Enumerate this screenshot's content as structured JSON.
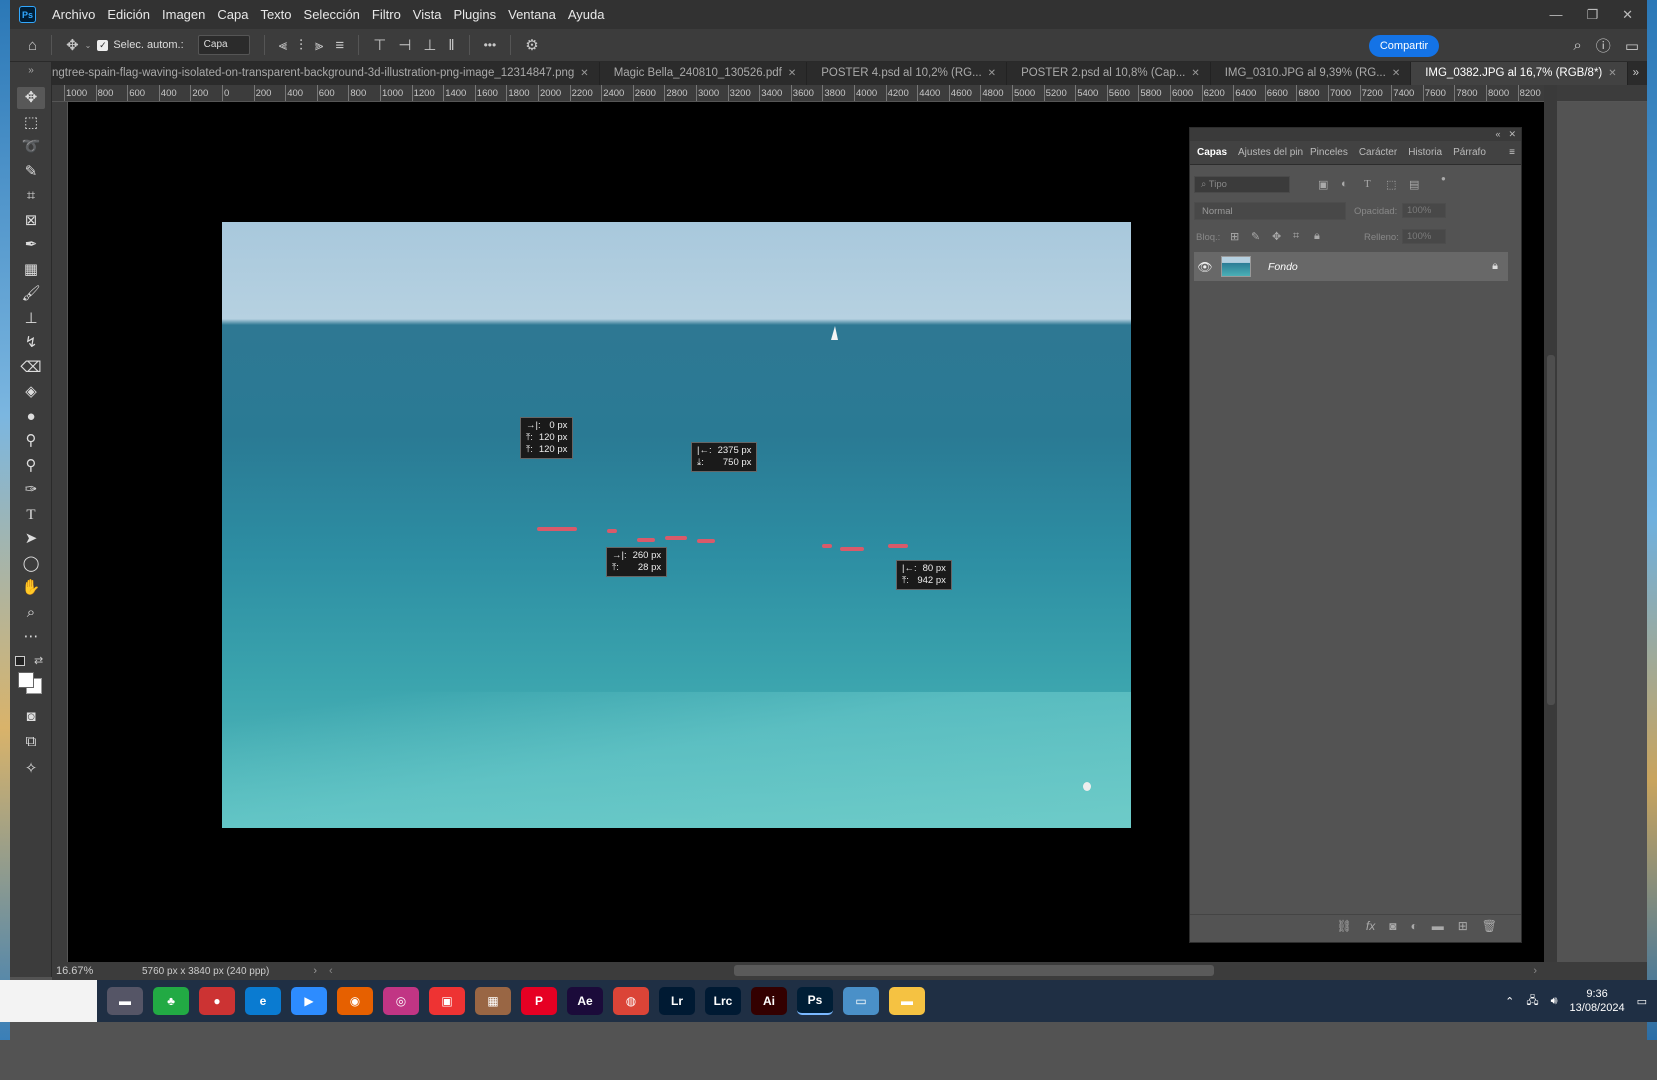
{
  "menubar": {
    "logo": "Ps",
    "items": [
      "Archivo",
      "Edición",
      "Imagen",
      "Capa",
      "Texto",
      "Selección",
      "Filtro",
      "Vista",
      "Plugins",
      "Ventana",
      "Ayuda"
    ],
    "window_controls": [
      "—",
      "❐",
      "✕"
    ]
  },
  "optionsbar": {
    "auto_select_label": "Selec. autom.:",
    "auto_select_checked": true,
    "target_select": "Capa",
    "more_label": "•••",
    "share_label": "Compartir"
  },
  "tabs": [
    {
      "label": "ngtree-spain-flag-waving-isolated-on-transparent-background-3d-illustration-png-image_12314847.png",
      "active": false
    },
    {
      "label": "Magic Bella_240810_130526.pdf",
      "active": false
    },
    {
      "label": "POSTER 4.psd al 10,2% (RG...",
      "active": false
    },
    {
      "label": "POSTER 2.psd al 10,8% (Cap...",
      "active": false
    },
    {
      "label": "IMG_0310.JPG al 9,39% (RG...",
      "active": false
    },
    {
      "label": "IMG_0382.JPG al 16,7% (RGB/8*)",
      "active": true
    }
  ],
  "ruler": {
    "top_ticks": [
      "1000",
      "800",
      "600",
      "400",
      "200",
      "0",
      "200",
      "400",
      "600",
      "800",
      "1000",
      "1200",
      "1400",
      "1600",
      "1800",
      "2000",
      "2200",
      "2400",
      "2600",
      "2800",
      "3000",
      "3200",
      "3400",
      "3600",
      "3800",
      "4000",
      "4200",
      "4400",
      "4600",
      "4800",
      "5000",
      "5200",
      "5400",
      "5600",
      "5800",
      "6000",
      "6200",
      "6400",
      "6600",
      "6800",
      "7000",
      "7200",
      "7400",
      "7600",
      "7800",
      "8000",
      "8200"
    ]
  },
  "measure_tips": [
    {
      "rows": [
        [
          "→|:",
          "0 px"
        ],
        [
          "⤒:",
          "120 px"
        ],
        [
          "⤒:",
          "120 px"
        ]
      ]
    },
    {
      "rows": [
        [
          "|←:",
          "2375 px"
        ],
        [
          "⤓:",
          "750 px"
        ]
      ]
    },
    {
      "rows": [
        [
          "→|:",
          "260 px"
        ],
        [
          "⤒:",
          "28 px"
        ]
      ]
    },
    {
      "rows": [
        [
          "|←:",
          "80 px"
        ],
        [
          "⤒:",
          "942 px"
        ]
      ]
    }
  ],
  "panel": {
    "tabs": [
      "Capas",
      "Ajustes del pin",
      "Pinceles",
      "Carácter",
      "Historia",
      "Párrafo"
    ],
    "active_tab": "Capas",
    "filter_placeholder": "Tipo",
    "blend_mode": "Normal",
    "opacity_label": "Opacidad:",
    "opacity_value": "100%",
    "lock_label": "Bloq.:",
    "fill_label": "Relleno:",
    "fill_value": "100%",
    "layers": [
      {
        "name": "Fondo",
        "visible": true,
        "locked": true
      }
    ]
  },
  "status": {
    "zoom": "16.67%",
    "doc_info": "5760 px x 3840 px (240 ppp)"
  },
  "taskbar": {
    "apps": [
      "folder-sm",
      "game",
      "maps",
      "edge",
      "zoom",
      "firefox",
      "instagram",
      "canva",
      "media",
      "pinterest",
      "Ae",
      "chrome",
      "Lr",
      "Lrc",
      "Ai",
      "Ps",
      "photos",
      "explorer"
    ],
    "time": "9:36",
    "date": "13/08/2024"
  },
  "colors": {
    "accent": "#1473e6",
    "kayak": "#d95a6a",
    "sea": "#2a7a94"
  }
}
